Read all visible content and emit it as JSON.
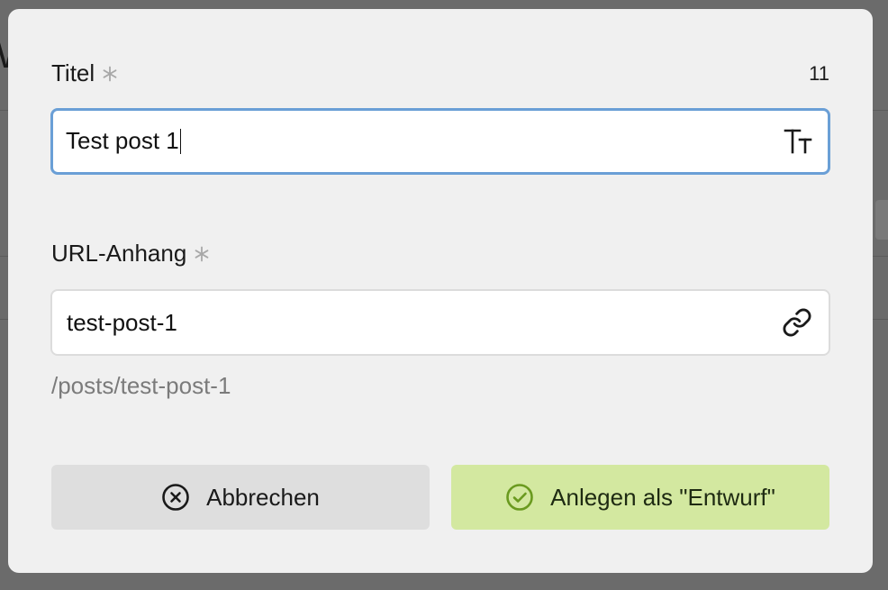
{
  "background": {
    "glyph": "W"
  },
  "dialog": {
    "title_field": {
      "label": "Titel",
      "required_icon": "asterisk-icon",
      "counter": "11",
      "value": "Test post 1",
      "icon": "text-size-icon"
    },
    "slug_field": {
      "label": "URL-Anhang",
      "required_icon": "asterisk-icon",
      "value": "test-post-1",
      "icon": "link-icon",
      "path_preview": "/posts/test-post-1"
    },
    "buttons": {
      "cancel_label": "Abbrechen",
      "cancel_icon": "circle-x-icon",
      "create_label": "Anlegen als \"Entwurf\"",
      "create_icon": "circle-check-icon"
    }
  },
  "colors": {
    "focus_border": "#6a9fd6",
    "create_button_bg": "#d3e8a0",
    "create_icon": "#6a9a1f",
    "cancel_button_bg": "#dedede"
  }
}
